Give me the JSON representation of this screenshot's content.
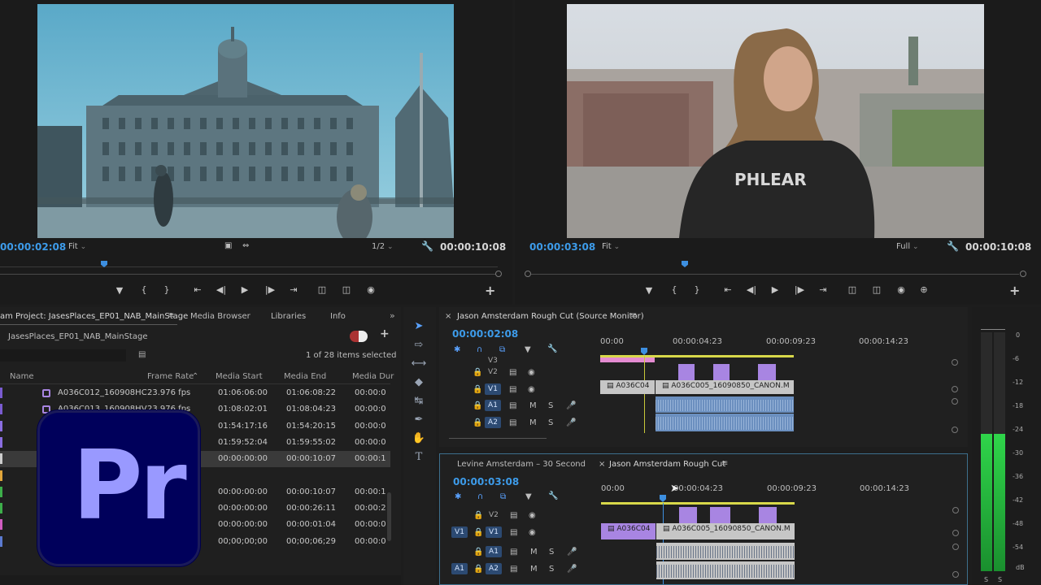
{
  "source_monitor": {
    "timecode": "00:00:02:08",
    "fit": "Fit",
    "resolution": "1/2",
    "duration": "00:00:10:08"
  },
  "program_monitor": {
    "timecode": "00:00:03:08",
    "fit": "Fit",
    "quality": "Full",
    "duration": "00:00:10:08"
  },
  "project_panel": {
    "tabs": [
      "am Project: JasesPlaces_EP01_NAB_MainStage",
      "Media Browser",
      "Libraries",
      "Info"
    ],
    "bin_name": "JasesPlaces_EP01_NAB_MainStage",
    "items_selected": "1 of 28 items selected",
    "columns": [
      "Name",
      "Frame Rate",
      "Media Start",
      "Media End",
      "Media Dur"
    ],
    "rows": [
      {
        "name": "A036C012_160908HC",
        "rate": "23.976 fps",
        "start": "01:06:06:00",
        "end": "01:06:08:22",
        "dur": "00:00:0"
      },
      {
        "name": "A036C013_160908HV",
        "rate": "23.976 fps",
        "start": "01:08:02:01",
        "end": "01:08:04:23",
        "dur": "00:00:0"
      },
      {
        "name": "",
        "rate": "",
        "start": "01:54:17:16",
        "end": "01:54:20:15",
        "dur": "00:00:0"
      },
      {
        "name": "",
        "rate": "",
        "start": "01:59:52:04",
        "end": "01:59:55:02",
        "dur": "00:00:0"
      },
      {
        "name": "",
        "rate": "",
        "start": "00:00:00:00",
        "end": "00:00:10:07",
        "dur": "00:00:1"
      },
      {
        "name": "",
        "rate": "",
        "start": "",
        "end": "",
        "dur": ""
      },
      {
        "name": "",
        "rate": "",
        "start": "00:00:00:00",
        "end": "00:00:10:07",
        "dur": "00:00:1"
      },
      {
        "name": "",
        "rate": "",
        "start": "00:00:00:00",
        "end": "00:00:26:11",
        "dur": "00:00:2"
      },
      {
        "name": "",
        "rate": "",
        "start": "00:00:00:00",
        "end": "00:00:01:04",
        "dur": "00:00:0"
      },
      {
        "name": "",
        "rate": "",
        "start": "00;00;00;00",
        "end": "00;00;06;29",
        "dur": "00:00:0"
      }
    ]
  },
  "source_timeline": {
    "title": "Jason Amsterdam Rough Cut (Source Monitor)",
    "timecode": "00:00:02:08",
    "ruler": [
      "00:00",
      "00:00:04:23",
      "00:00:09:23",
      "00:00:14:23"
    ],
    "tracks": [
      "V3",
      "V2",
      "V1",
      "A1",
      "A2"
    ],
    "clip_a": "A036C04",
    "clip_b": "A036C005_16090850_CANON.M"
  },
  "program_timeline": {
    "tabs": [
      "Levine Amsterdam – 30 Second",
      "Jason Amsterdam Rough Cut"
    ],
    "timecode": "00:00:03:08",
    "ruler": [
      "00:00",
      "00:00:04:23",
      "00:00:09:23",
      "00:00:14:23"
    ],
    "tracks": [
      "V2",
      "V1",
      "A1",
      "A2"
    ],
    "src_patch": [
      "V1",
      "A1"
    ],
    "clip_a": "A036C04",
    "clip_b": "A036C005_16090850_CANON.M"
  },
  "track_controls": {
    "mute": "M",
    "solo": "S"
  },
  "meter": {
    "labels": [
      "0",
      "-6",
      "-12",
      "-18",
      "-24",
      "-30",
      "-36",
      "-42",
      "-48",
      "-54",
      "dB"
    ],
    "bottom": [
      "S",
      "S"
    ]
  },
  "logo_text": "Pr",
  "colors": {
    "accent_blue": "#3d9be9",
    "clip_purple": "#a885e2",
    "audio_blue": "#6b8fbf",
    "logo_bg": "#00005b",
    "logo_fg": "#9999ff"
  }
}
